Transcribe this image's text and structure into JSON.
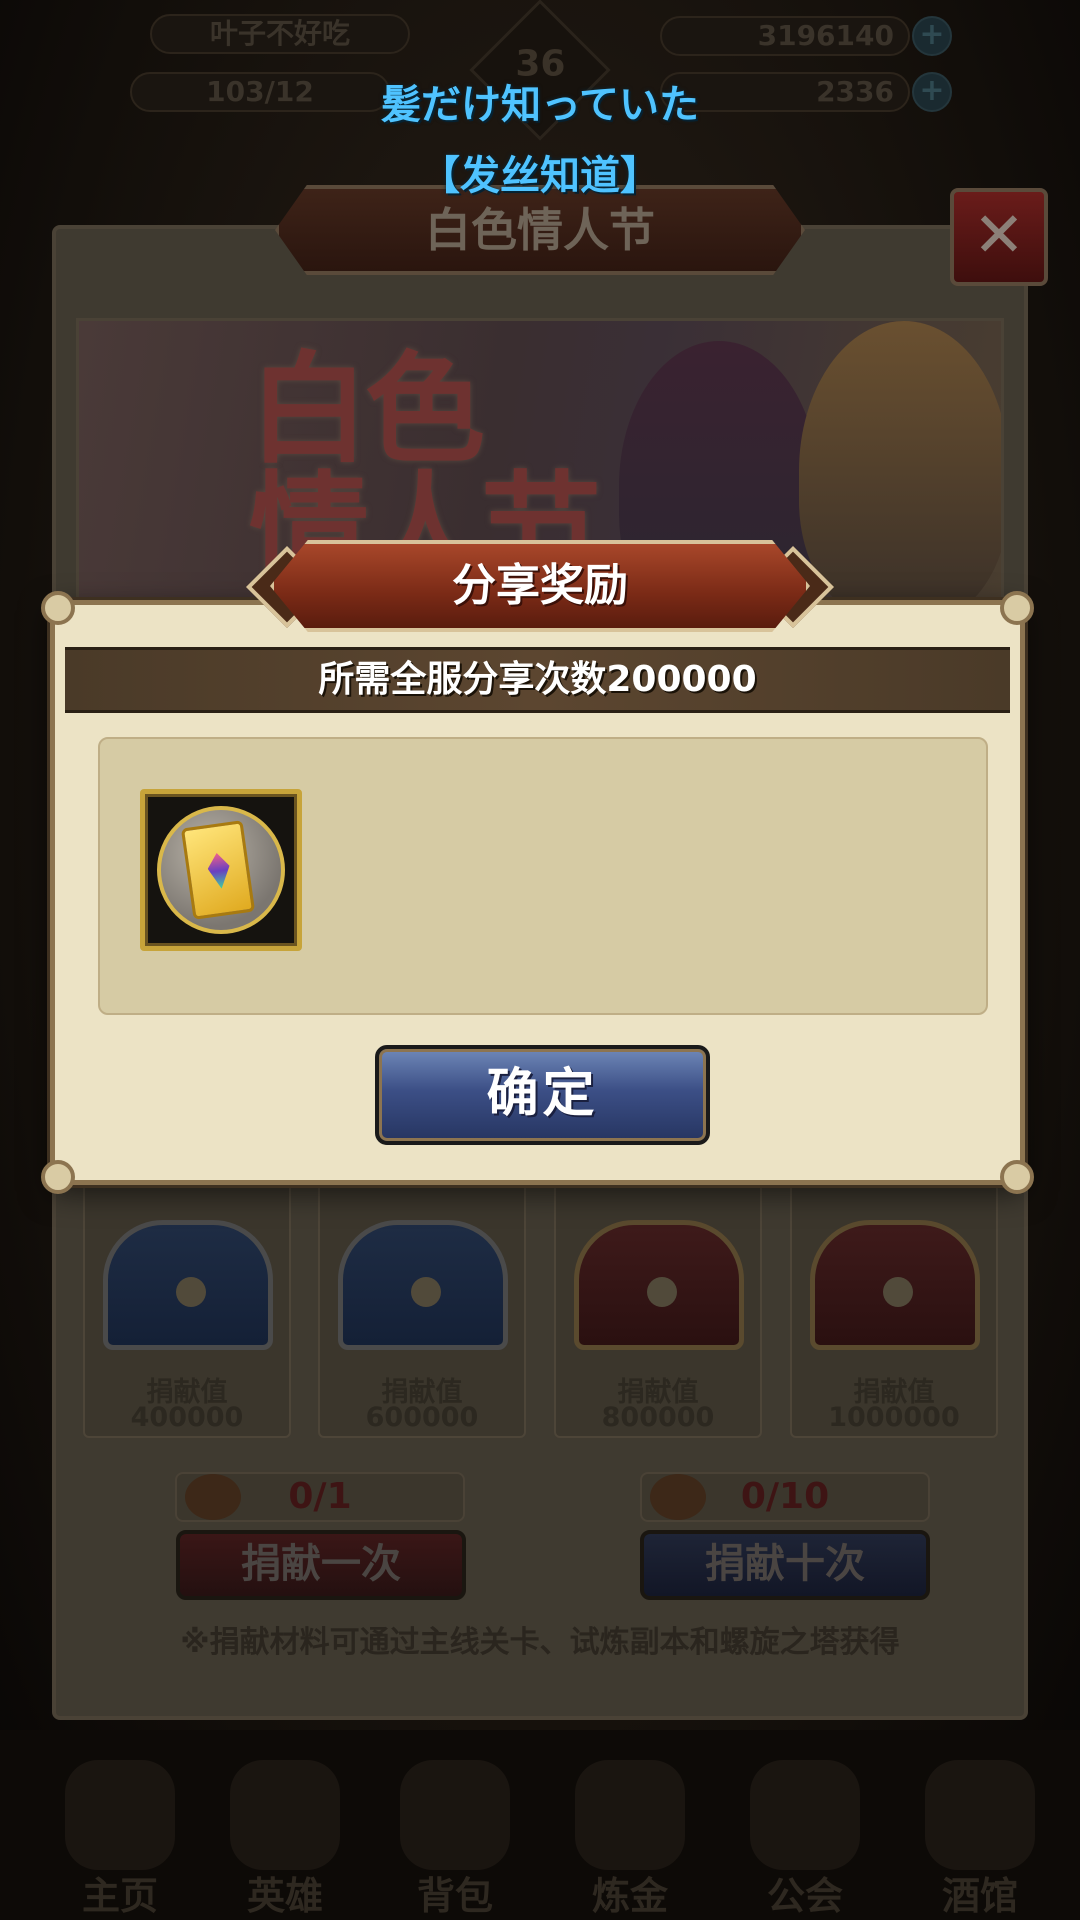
{
  "hud": {
    "player_name": "叶子不好吃",
    "level": "36",
    "stamina": "103/12",
    "gold": "3196140",
    "gems": "2336"
  },
  "caption": {
    "jp": "髪だけ知っていた",
    "cn": "【发丝知道】"
  },
  "back_panel": {
    "title": "白色情人节",
    "banner_text": "白色\n情人节",
    "chests": [
      {
        "label": "捐献值",
        "value": "400000",
        "color": "blue"
      },
      {
        "label": "捐献值",
        "value": "600000",
        "color": "blue"
      },
      {
        "label": "捐献值",
        "value": "800000",
        "color": "red"
      },
      {
        "label": "捐献值",
        "value": "1000000",
        "color": "red"
      }
    ],
    "counter_left": "0/1",
    "counter_right": "0/10",
    "donate_once": "捐献一次",
    "donate_ten": "捐献十次",
    "note": "※捐献材料可通过主线关卡、试炼副本和螺旋之塔获得"
  },
  "dialog": {
    "title": "分享奖励",
    "requirement": "所需全服分享次数200000",
    "reward_icon": "ticket-scroll-icon",
    "confirm": "确定"
  },
  "nav": [
    {
      "label": "主页",
      "icon": "home-icon"
    },
    {
      "label": "英雄",
      "icon": "hero-icon"
    },
    {
      "label": "背包",
      "icon": "bag-icon"
    },
    {
      "label": "炼金",
      "icon": "alchemy-icon"
    },
    {
      "label": "公会",
      "icon": "guild-icon"
    },
    {
      "label": "酒馆",
      "icon": "tavern-icon"
    }
  ],
  "colors": {
    "caption": "#4fc3ff",
    "dialog_bg": "#ece3c5",
    "dialog_title": "#7a2a16",
    "confirm_button": "#3c4f86"
  }
}
